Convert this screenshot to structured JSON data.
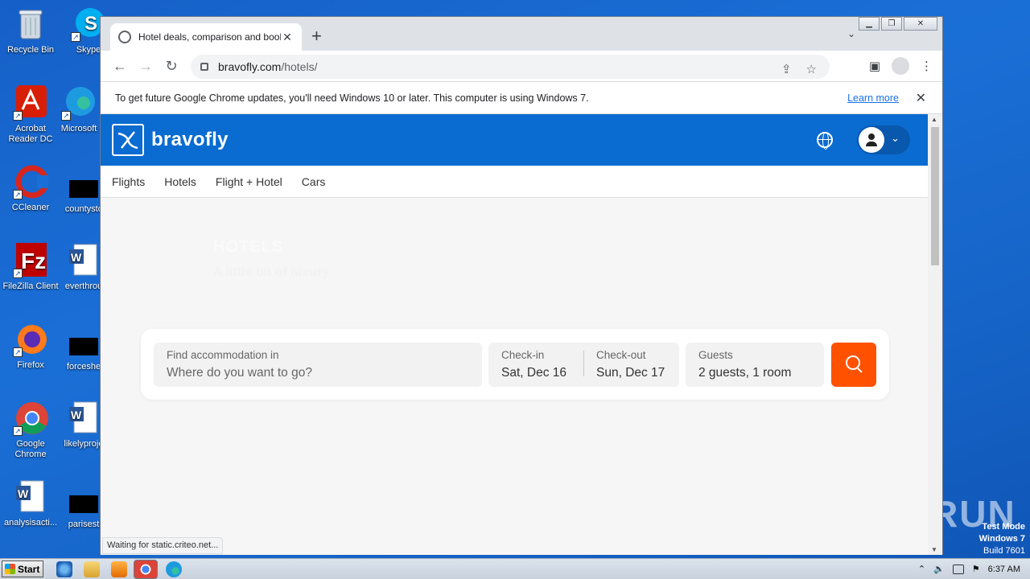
{
  "desktop": {
    "icons": [
      {
        "label": "Recycle Bin",
        "icon": "recycle-bin-icon"
      },
      {
        "label": "Skype",
        "icon": "skype-icon"
      },
      {
        "label": "Acrobat Reader DC",
        "icon": "acrobat-icon"
      },
      {
        "label": "Microsoft",
        "icon": "edge-icon"
      },
      {
        "label": "CCleaner",
        "icon": "ccleaner-icon"
      },
      {
        "label": "countystc",
        "icon": "file-icon"
      },
      {
        "label": "FileZilla Client",
        "icon": "filezilla-icon"
      },
      {
        "label": "everthrou",
        "icon": "word-doc-icon"
      },
      {
        "label": "Firefox",
        "icon": "firefox-icon"
      },
      {
        "label": "forceshe",
        "icon": "file-icon"
      },
      {
        "label": "Google Chrome",
        "icon": "chrome-icon"
      },
      {
        "label": "likelyproje",
        "icon": "word-doc-icon"
      },
      {
        "label": "analysisacti...",
        "icon": "word-doc-icon"
      },
      {
        "label": "parisest",
        "icon": "file-icon"
      }
    ]
  },
  "browser": {
    "tab_title": "Hotel deals, comparison and booking",
    "url_domain": "bravofly.com",
    "url_path": "/hotels/",
    "infobar_text": "To get future Google Chrome updates, you'll need Windows 10 or later. This computer is using Windows 7.",
    "infobar_link": "Learn more",
    "status_text": "Waiting for static.criteo.net..."
  },
  "site": {
    "brand": "bravofly",
    "nav": [
      "Flights",
      "Hotels",
      "Flight + Hotel",
      "Cars"
    ],
    "hero_title": "HOTELS",
    "hero_subtitle": "A little bit of luxury",
    "search": {
      "destination_label": "Find accommodation in",
      "destination_placeholder": "Where do you want to go?",
      "checkin_label": "Check-in",
      "checkin_value": "Sat, Dec 16",
      "checkout_label": "Check-out",
      "checkout_value": "Sun, Dec 17",
      "guests_label": "Guests",
      "guests_value": "2 guests, 1 room"
    },
    "colors": {
      "header": "#0a6bd0",
      "search_button": "#ff5100"
    }
  },
  "taskbar": {
    "start_label": "Start",
    "clock": "6:37 AM"
  },
  "overlay": {
    "watermark": "ANY RUN",
    "test_mode_line1": "Test Mode",
    "test_mode_line2": "Windows 7",
    "test_mode_line3": "Build 7601"
  }
}
